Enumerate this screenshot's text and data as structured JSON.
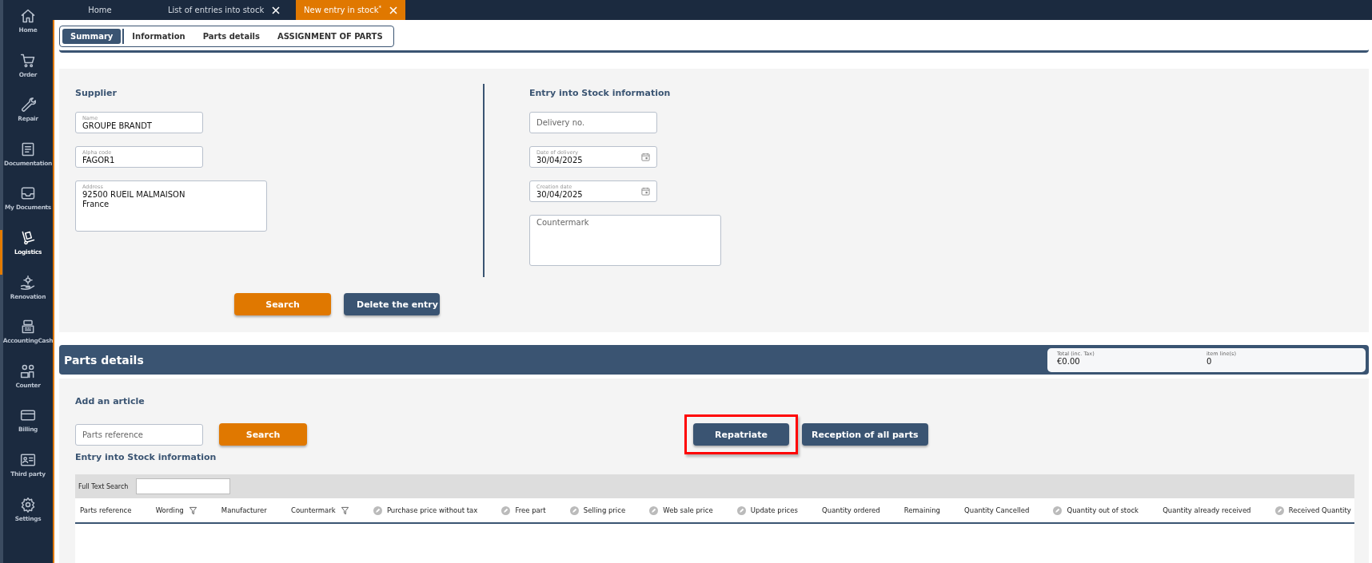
{
  "sidebar": {
    "items": [
      {
        "label": "Home",
        "selected": false
      },
      {
        "label": "Order",
        "selected": false
      },
      {
        "label": "Repair",
        "selected": false
      },
      {
        "label": "Documentation",
        "selected": false
      },
      {
        "label": "My Documents",
        "selected": false
      },
      {
        "label": "Logistics",
        "selected": true
      },
      {
        "label": "Renovation",
        "selected": false
      },
      {
        "label": "AccountingCash",
        "selected": false
      },
      {
        "label": "Counter",
        "selected": false
      },
      {
        "label": "Billing",
        "selected": false
      },
      {
        "label": "Third party",
        "selected": false
      },
      {
        "label": "Settings",
        "selected": false
      }
    ]
  },
  "tabs": [
    {
      "label": "Home",
      "closable": false,
      "selected": false
    },
    {
      "label": "List of entries into stock",
      "closable": true,
      "selected": false
    },
    {
      "label": "New entry in stock$^{*}$",
      "closable": true,
      "selected": true
    }
  ],
  "subtabs": [
    {
      "label": "Summary",
      "selected": true
    },
    {
      "label": "Information",
      "selected": false
    },
    {
      "label": "Parts details",
      "selected": false
    },
    {
      "label": "ASSIGNMENT OF PARTS",
      "selected": false
    }
  ],
  "supplier": {
    "title": "Supplier",
    "fields": [
      {
        "kind": "text",
        "label": "Name",
        "value": "GROUPE BRANDT"
      },
      {
        "kind": "text",
        "label": "Alpha code",
        "value": "FAGOR1"
      },
      {
        "kind": "textarea",
        "label": "Address",
        "value": "92500 RUEIL MALMAISON\nFrance"
      }
    ]
  },
  "entry_info": {
    "title": "Entry into Stock information",
    "fields": [
      {
        "kind": "text",
        "placeholder": "Delivery no."
      },
      {
        "kind": "date",
        "label": "Date of delivery",
        "value": "30/04/2025"
      },
      {
        "kind": "date",
        "label": "Creation date",
        "value": "30/04/2025"
      },
      {
        "kind": "textarea",
        "placeholder": "Countermark"
      }
    ]
  },
  "form_buttons": [
    {
      "label": "Search",
      "kind": "primary"
    },
    {
      "label": "Delete the entry",
      "kind": "secondary"
    }
  ],
  "parts_details": {
    "title": "Parts details",
    "summary": [
      {
        "label": "Total (inc. Tax)",
        "value": "€0.00"
      },
      {
        "label": "item line(s)",
        "value": "0"
      }
    ]
  },
  "add_article": {
    "title": "Add an article",
    "field": {
      "placeholder": "Parts reference"
    },
    "search_button": "Search",
    "actions": [
      {
        "label": "Repatriate",
        "highlighted": true
      },
      {
        "label": "Reception of all parts",
        "highlighted": false
      }
    ]
  },
  "stock_table": {
    "title": "Entry into Stock information",
    "search_label": "Full Text Search",
    "columns": [
      {
        "label": "Parts reference",
        "filter": false,
        "editable": false
      },
      {
        "label": "Wording",
        "filter": true,
        "editable": false
      },
      {
        "label": "Manufacturer",
        "filter": false,
        "editable": false
      },
      {
        "label": "Countermark",
        "filter": true,
        "editable": false
      },
      {
        "label": "Purchase price without tax",
        "filter": false,
        "editable": true
      },
      {
        "label": "Free part",
        "filter": false,
        "editable": true
      },
      {
        "label": "Selling price",
        "filter": false,
        "editable": true
      },
      {
        "label": "Web sale price",
        "filter": false,
        "editable": true
      },
      {
        "label": "Update prices",
        "filter": false,
        "editable": true
      },
      {
        "label": "Quantity ordered",
        "filter": false,
        "editable": false
      },
      {
        "label": "Remaining",
        "filter": false,
        "editable": false
      },
      {
        "label": "Quantity Cancelled",
        "filter": false,
        "editable": false
      },
      {
        "label": "Quantity out of stock",
        "filter": false,
        "editable": true
      },
      {
        "label": "Quantity already received",
        "filter": false,
        "editable": false
      },
      {
        "label": "Received Quantity",
        "filter": false,
        "editable": true
      }
    ]
  }
}
